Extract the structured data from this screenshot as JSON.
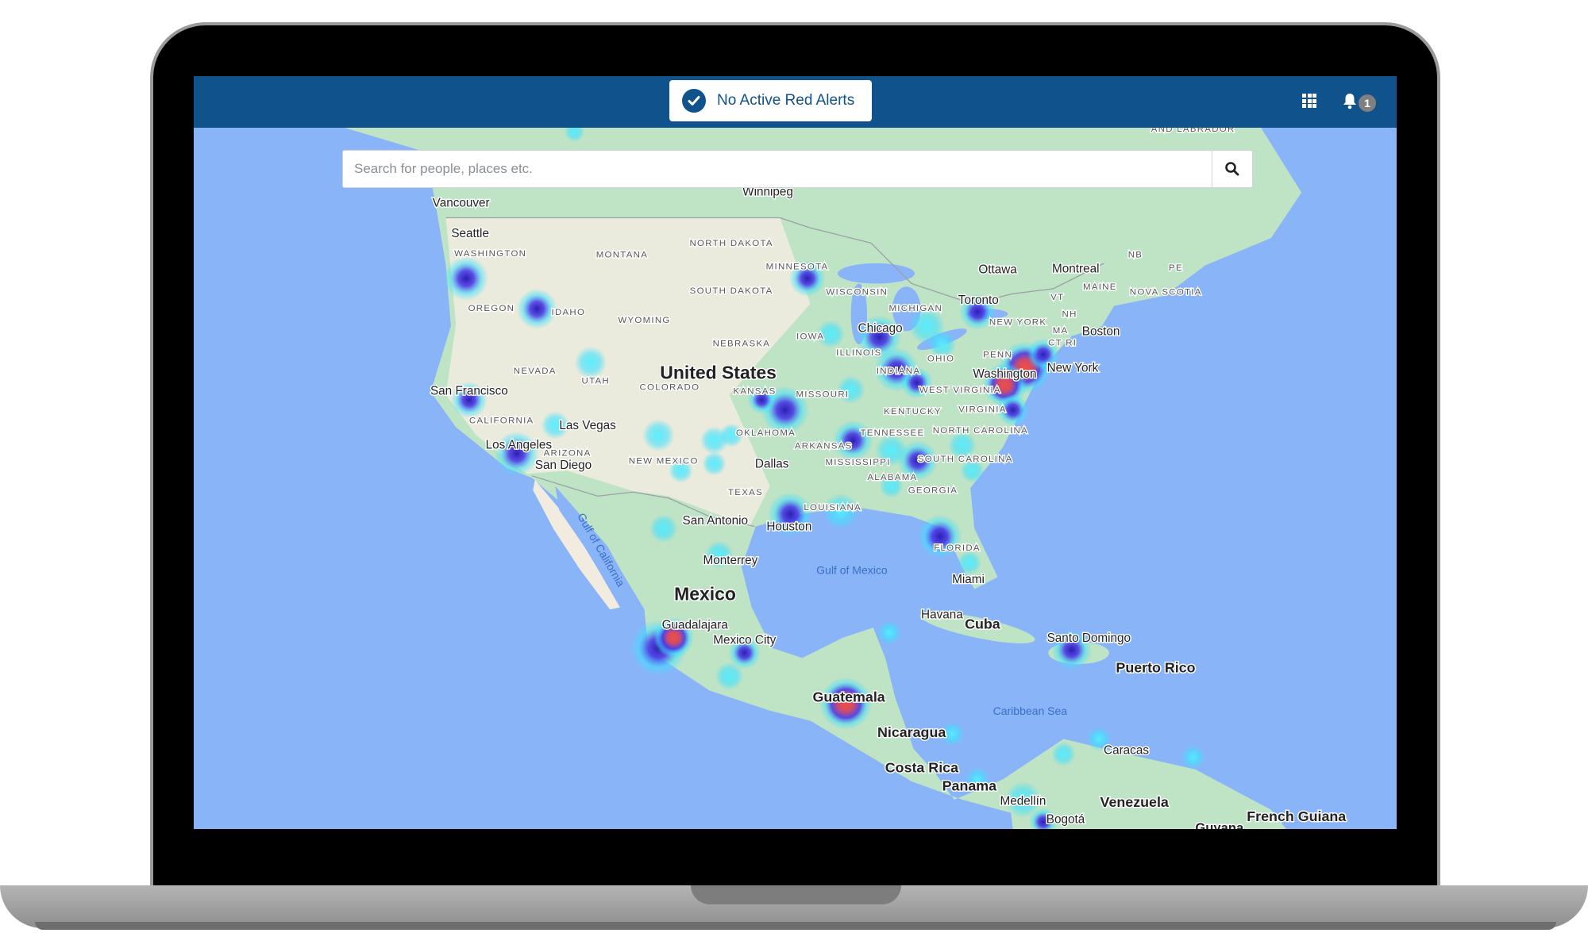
{
  "header": {
    "alert_status": "No Active Red Alerts",
    "apps_icon": "grid-icon",
    "notifications_icon": "bell-icon",
    "notification_count": "1",
    "brand_color": "#10528b"
  },
  "search": {
    "placeholder": "Search for people, places etc.",
    "value": "",
    "icon": "search-icon"
  },
  "map": {
    "country_labels": [
      "United States",
      "Mexico",
      "Cuba",
      "Nicaragua",
      "Costa Rica",
      "Panama",
      "Venezuela",
      "Guatemala",
      "Puerto Rico",
      "French Guiana",
      "Guyana"
    ],
    "state_labels": [
      "WASHINGTON",
      "OREGON",
      "IDAHO",
      "MONTANA",
      "WYOMING",
      "NORTH DAKOTA",
      "SOUTH DAKOTA",
      "NEBRASKA",
      "NEVADA",
      "UTAH",
      "COLORADO",
      "KANSAS",
      "CALIFORNIA",
      "ARIZONA",
      "NEW MEXICO",
      "OKLAHOMA",
      "TEXAS",
      "MINNESOTA",
      "IOWA",
      "WISCONSIN",
      "ILLINOIS",
      "MISSOURI",
      "ARKANSAS",
      "LOUISIANA",
      "MISSISSIPPI",
      "ALABAMA",
      "TENNESSEE",
      "KENTUCKY",
      "INDIANA",
      "OHIO",
      "MICHIGAN",
      "GEORGIA",
      "FLORIDA",
      "SOUTH CAROLINA",
      "NORTH CAROLINA",
      "VIRGINIA",
      "WEST VIRGINIA",
      "PENN",
      "NEW YORK",
      "VT",
      "NH",
      "MA",
      "CT RI",
      "MAINE",
      "NB",
      "PE",
      "NOVA SCOTIA",
      "AND LABRADOR"
    ],
    "city_labels": [
      "Vancouver",
      "Seattle",
      "Winnipeg",
      "Ottawa",
      "Montreal",
      "Toronto",
      "Boston",
      "New York",
      "Washington",
      "Chicago",
      "San Francisco",
      "Las Vegas",
      "Los Angeles",
      "San Diego",
      "Dallas",
      "San Antonio",
      "Houston",
      "Monterrey",
      "Guadalajara",
      "Mexico City",
      "Miami",
      "Havana",
      "Santo Domingo",
      "Caracas",
      "Medellín",
      "Bogotá"
    ],
    "water_labels": [
      "Gulf of Mexico",
      "Caribbean Sea",
      "Gulf of California"
    ],
    "heatmap_colors": {
      "low": "#3ee0ff",
      "mid": "#3b2fd9",
      "high": "#e0443a"
    }
  }
}
